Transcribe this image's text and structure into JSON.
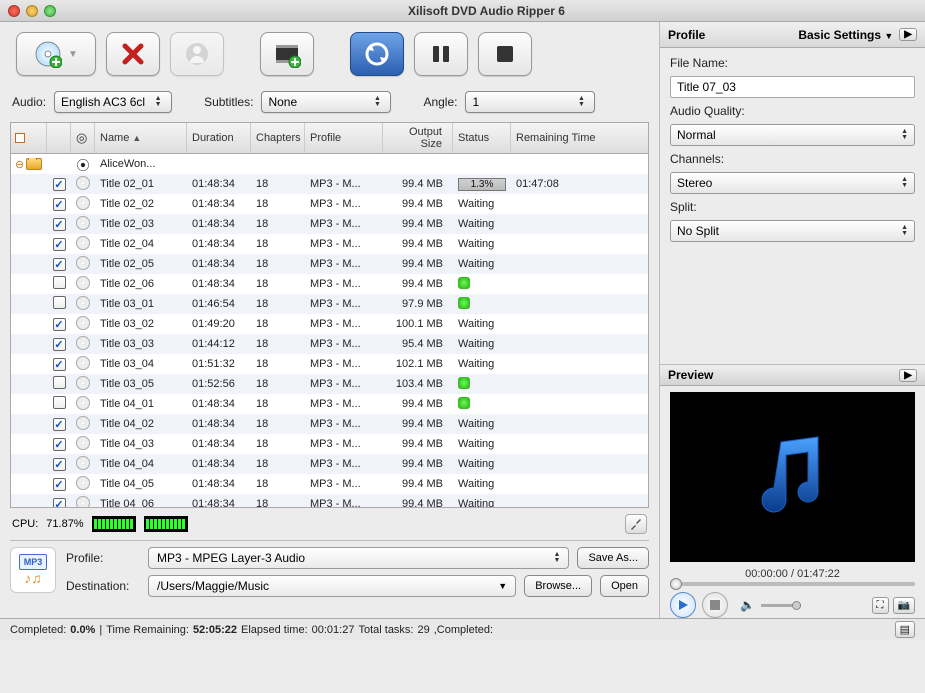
{
  "window": {
    "title": "Xilisoft DVD Audio Ripper 6"
  },
  "filters": {
    "audio_label": "Audio:",
    "audio_value": "English AC3 6cl",
    "subtitles_label": "Subtitles:",
    "subtitles_value": "None",
    "angle_label": "Angle:",
    "angle_value": "1"
  },
  "columns": {
    "name": "Name",
    "duration": "Duration",
    "chapters": "Chapters",
    "profile": "Profile",
    "output": "Output Size",
    "status": "Status",
    "remaining": "Remaining Time"
  },
  "group": {
    "name": "AliceWon..."
  },
  "rows": [
    {
      "chk": true,
      "name": "Title 02_01",
      "dur": "01:48:34",
      "chap": "18",
      "prof": "MP3 - M...",
      "out": "99.4 MB",
      "status": "progress",
      "progress": "1.3%",
      "rem": "01:47:08"
    },
    {
      "chk": true,
      "name": "Title 02_02",
      "dur": "01:48:34",
      "chap": "18",
      "prof": "MP3 - M...",
      "out": "99.4 MB",
      "status": "Waiting"
    },
    {
      "chk": true,
      "name": "Title 02_03",
      "dur": "01:48:34",
      "chap": "18",
      "prof": "MP3 - M...",
      "out": "99.4 MB",
      "status": "Waiting"
    },
    {
      "chk": true,
      "name": "Title 02_04",
      "dur": "01:48:34",
      "chap": "18",
      "prof": "MP3 - M...",
      "out": "99.4 MB",
      "status": "Waiting"
    },
    {
      "chk": true,
      "name": "Title 02_05",
      "dur": "01:48:34",
      "chap": "18",
      "prof": "MP3 - M...",
      "out": "99.4 MB",
      "status": "Waiting"
    },
    {
      "chk": false,
      "name": "Title 02_06",
      "dur": "01:48:34",
      "chap": "18",
      "prof": "MP3 - M...",
      "out": "99.4 MB",
      "status": "done"
    },
    {
      "chk": false,
      "name": "Title 03_01",
      "dur": "01:46:54",
      "chap": "18",
      "prof": "MP3 - M...",
      "out": "97.9 MB",
      "status": "done"
    },
    {
      "chk": true,
      "name": "Title 03_02",
      "dur": "01:49:20",
      "chap": "18",
      "prof": "MP3 - M...",
      "out": "100.1 MB",
      "status": "Waiting"
    },
    {
      "chk": true,
      "name": "Title 03_03",
      "dur": "01:44:12",
      "chap": "18",
      "prof": "MP3 - M...",
      "out": "95.4 MB",
      "status": "Waiting"
    },
    {
      "chk": true,
      "name": "Title 03_04",
      "dur": "01:51:32",
      "chap": "18",
      "prof": "MP3 - M...",
      "out": "102.1 MB",
      "status": "Waiting"
    },
    {
      "chk": false,
      "name": "Title 03_05",
      "dur": "01:52:56",
      "chap": "18",
      "prof": "MP3 - M...",
      "out": "103.4 MB",
      "status": "done"
    },
    {
      "chk": false,
      "name": "Title 04_01",
      "dur": "01:48:34",
      "chap": "18",
      "prof": "MP3 - M...",
      "out": "99.4 MB",
      "status": "done"
    },
    {
      "chk": true,
      "name": "Title 04_02",
      "dur": "01:48:34",
      "chap": "18",
      "prof": "MP3 - M...",
      "out": "99.4 MB",
      "status": "Waiting"
    },
    {
      "chk": true,
      "name": "Title 04_03",
      "dur": "01:48:34",
      "chap": "18",
      "prof": "MP3 - M...",
      "out": "99.4 MB",
      "status": "Waiting"
    },
    {
      "chk": true,
      "name": "Title 04_04",
      "dur": "01:48:34",
      "chap": "18",
      "prof": "MP3 - M...",
      "out": "99.4 MB",
      "status": "Waiting"
    },
    {
      "chk": true,
      "name": "Title 04_05",
      "dur": "01:48:34",
      "chap": "18",
      "prof": "MP3 - M...",
      "out": "99.4 MB",
      "status": "Waiting"
    },
    {
      "chk": true,
      "name": "Title 04_06",
      "dur": "01:48:34",
      "chap": "18",
      "prof": "MP3 - M...",
      "out": "99.4 MB",
      "status": "Waiting"
    }
  ],
  "cpu": {
    "label": "CPU:",
    "value": "71.87%"
  },
  "bottom": {
    "profile_label": "Profile:",
    "profile_value": "MP3 - MPEG Layer-3 Audio",
    "saveas": "Save As...",
    "dest_label": "Destination:",
    "dest_value": "/Users/Maggie/Music",
    "browse": "Browse...",
    "open": "Open"
  },
  "statusbar": {
    "completed_lbl": "Completed:",
    "completed_val": "0.0%",
    "sep1": " | ",
    "remain_lbl": "Time Remaining:",
    "remain_val": "52:05:22",
    "elapsed_lbl": " Elapsed time:",
    "elapsed_val": "00:01:27",
    "tasks_lbl": " Total tasks:",
    "tasks_val": "29",
    "trail": " ,Completed:"
  },
  "profile_panel": {
    "title": "Profile",
    "settings": "Basic Settings",
    "filename_lbl": "File Name:",
    "filename_val": "Title 07_03",
    "aq_lbl": "Audio Quality:",
    "aq_val": "Normal",
    "ch_lbl": "Channels:",
    "ch_val": "Stereo",
    "split_lbl": "Split:",
    "split_val": "No Split"
  },
  "preview": {
    "title": "Preview",
    "time": "00:00:00 / 01:47:22"
  }
}
